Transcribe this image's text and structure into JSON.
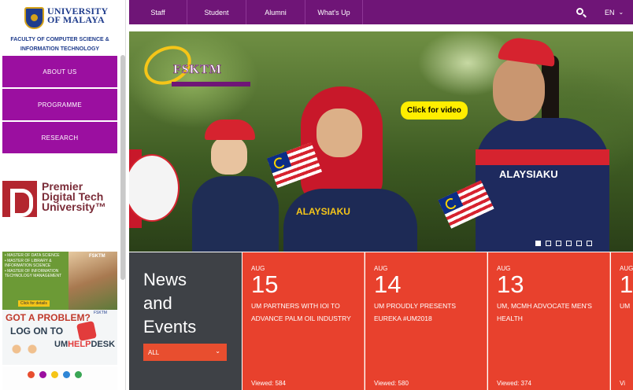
{
  "sidebar": {
    "logo": {
      "line1": "UNIVERSITY",
      "line2": "OF MALAYA"
    },
    "faculty": {
      "line1": "FACULTY OF COMPUTER SCIENCE &",
      "line2": "INFORMATION TECHNOLOGY"
    },
    "menu": [
      {
        "label": "ABOUT US"
      },
      {
        "label": "PROGRAMME"
      },
      {
        "label": "RESEARCH"
      }
    ],
    "banner_premier": {
      "line1": "Premier",
      "line2": "Digital Tech",
      "line3": "University™"
    },
    "banner_programmes": {
      "items": [
        "• MASTER OF DATA SCIENCE",
        "• MASTER OF LIBRARY & INFORMATION SCIENCE",
        "• MASTER OF INFORMATION TECHNOLOGY MANAGEMENT"
      ],
      "button": "Click for details",
      "logo": "FSKTM"
    },
    "banner_helpdesk": {
      "line1": "GOT A PROBLEM?",
      "line2": "LOG ON TO",
      "brand_prefix": "UM",
      "brand_accent": "HELP",
      "brand_suffix": "DESK",
      "logo": "FSKTM"
    }
  },
  "topnav": {
    "items": [
      {
        "label": "Staff"
      },
      {
        "label": "Student"
      },
      {
        "label": "Alumni"
      },
      {
        "label": "What's Up"
      }
    ],
    "lang": "EN"
  },
  "hero": {
    "logo_text": "FSKTM",
    "video_button": "Click for video",
    "jersey_text": "ALAYSIAKU",
    "jersey_text2": "ALAYSIAKU",
    "slides": 6,
    "active_slide": 1
  },
  "news": {
    "heading_line1": "News",
    "heading_line2": "and",
    "heading_line3": "Events",
    "filter": "ALL",
    "cards": [
      {
        "month": "AUG",
        "day": "15",
        "title": "UM PARTNERS WITH IOI TO ADVANCE PALM OIL INDUSTRY",
        "views": "Viewed: 584"
      },
      {
        "month": "AUG",
        "day": "14",
        "title": "UM PROUDLY PRESENTS EUREKA #UM2018",
        "views": "Viewed: 580"
      },
      {
        "month": "AUG",
        "day": "13",
        "title": "UM, MCMH ADVOCATE MEN'S HEALTH",
        "views": "Viewed: 374"
      },
      {
        "month": "AUG",
        "day": "1",
        "title": "UM",
        "views": "Vi"
      }
    ]
  },
  "colors": {
    "nav": "#6f1577",
    "menu": "#9b0fa0",
    "news_card": "#e8412d",
    "news_panel": "#3e4146",
    "video_button": "#ffee00"
  }
}
